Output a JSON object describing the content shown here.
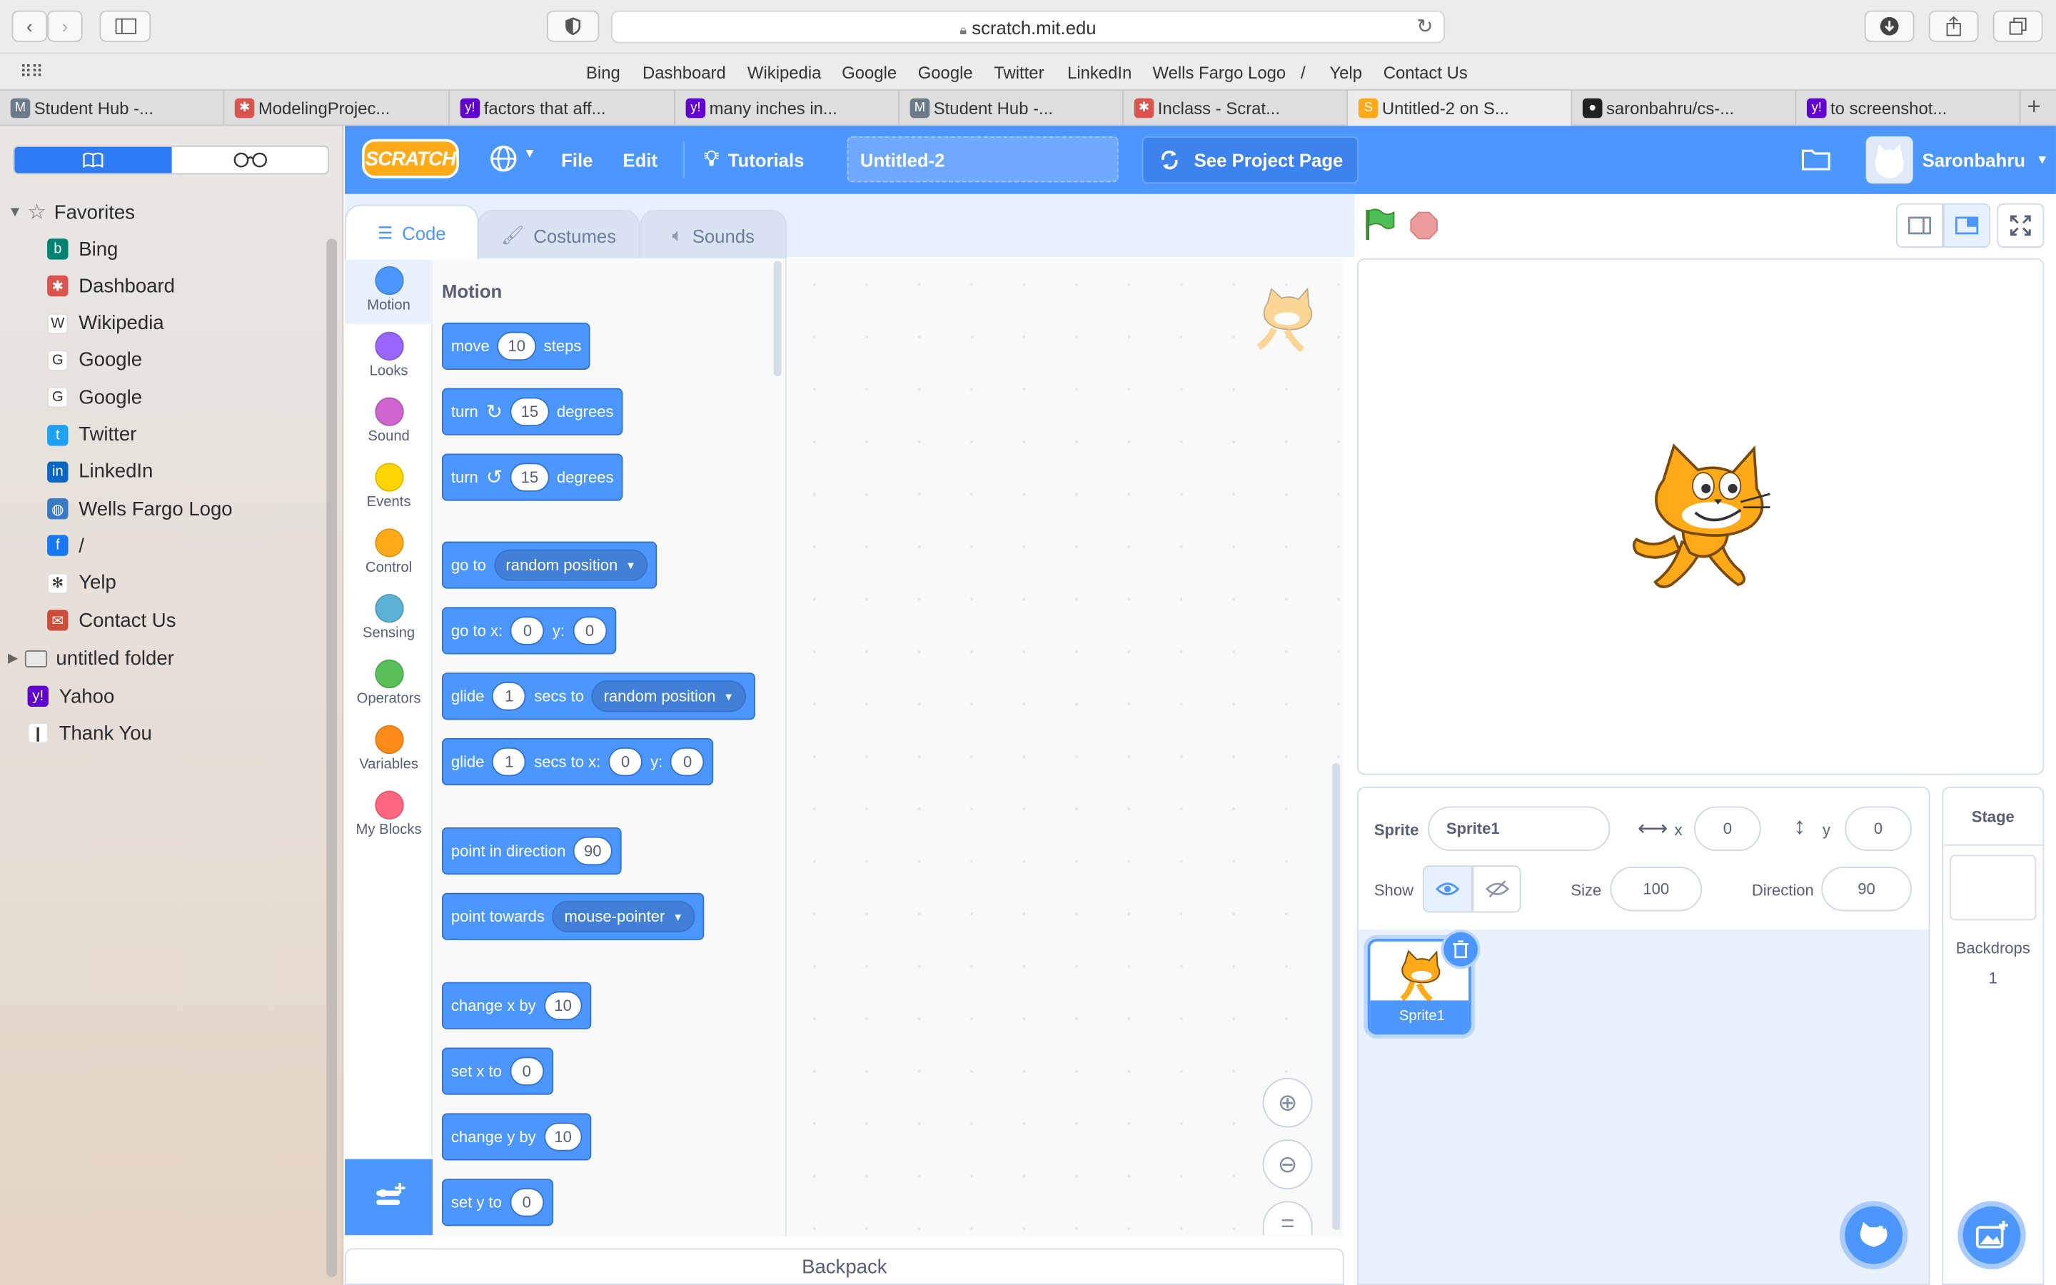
{
  "browser": {
    "url": "scratch.mit.edu",
    "favorites_bar": [
      "Bing",
      "Dashboard",
      "Wikipedia",
      "Google",
      "Google",
      "Twitter",
      "LinkedIn",
      "Wells Fargo Logo",
      "/",
      "Yelp",
      "Contact Us"
    ],
    "tabs": [
      {
        "label": "Student Hub -...",
        "color": "#6c7a89",
        "glyph": "M"
      },
      {
        "label": "ModelingProjec...",
        "color": "#d9534f",
        "glyph": "✱"
      },
      {
        "label": "factors that aff...",
        "color": "#6001d2",
        "glyph": "y!"
      },
      {
        "label": "many inches in...",
        "color": "#6001d2",
        "glyph": "y!"
      },
      {
        "label": "Student Hub -...",
        "color": "#6c7a89",
        "glyph": "M"
      },
      {
        "label": "Inclass - Scrat...",
        "color": "#d9534f",
        "glyph": "✱"
      },
      {
        "label": "Untitled-2 on S...",
        "color": "#ffab19",
        "glyph": "S"
      },
      {
        "label": "saronbahru/cs-...",
        "color": "#222222",
        "glyph": "●"
      },
      {
        "label": "to screenshot...",
        "color": "#6001d2",
        "glyph": "y!"
      }
    ]
  },
  "sidebar": {
    "heading": "Favorites",
    "items": [
      {
        "label": "Bing",
        "color": "#008373",
        "glyph": "b"
      },
      {
        "label": "Dashboard",
        "color": "#d9534f",
        "glyph": "✱"
      },
      {
        "label": "Wikipedia",
        "color": "#ffffff",
        "glyph": "W"
      },
      {
        "label": "Google",
        "color": "#ffffff",
        "glyph": "G"
      },
      {
        "label": "Google",
        "color": "#ffffff",
        "glyph": "G"
      },
      {
        "label": "Twitter",
        "color": "#1da1f2",
        "glyph": "t"
      },
      {
        "label": "LinkedIn",
        "color": "#0a66c2",
        "glyph": "in"
      },
      {
        "label": "Wells Fargo Logo",
        "color": "#3a78c2",
        "glyph": "◍"
      },
      {
        "label": "/",
        "color": "#1877f2",
        "glyph": "f"
      },
      {
        "label": "Yelp",
        "color": "#ffffff",
        "glyph": "✻"
      },
      {
        "label": "Contact Us",
        "color": "#c94f3a",
        "glyph": "✉"
      }
    ],
    "folder": "untitled folder",
    "extra": [
      {
        "label": "Yahoo",
        "color": "#6001d2",
        "glyph": "y!"
      },
      {
        "label": "Thank You",
        "color": "#ffffff",
        "glyph": "❙"
      }
    ]
  },
  "scratch": {
    "menu_file": "File",
    "menu_edit": "Edit",
    "tutorials": "Tutorials",
    "project_title": "Untitled-2",
    "see_project": "See Project Page",
    "username": "Saronbahru",
    "tab_code": "Code",
    "tab_costumes": "Costumes",
    "tab_sounds": "Sounds",
    "categories": [
      {
        "label": "Motion",
        "color": "#4c97ff"
      },
      {
        "label": "Looks",
        "color": "#9966ff"
      },
      {
        "label": "Sound",
        "color": "#cf63cf"
      },
      {
        "label": "Events",
        "color": "#ffd500"
      },
      {
        "label": "Control",
        "color": "#ffab19"
      },
      {
        "label": "Sensing",
        "color": "#5cb1d6"
      },
      {
        "label": "Operators",
        "color": "#59c059"
      },
      {
        "label": "Variables",
        "color": "#ff8c1a"
      },
      {
        "label": "My Blocks",
        "color": "#ff6680"
      }
    ],
    "palette_heading": "Motion",
    "blocks": {
      "move": {
        "t1": "move",
        "v1": "10",
        "t2": "steps"
      },
      "turn_cw": {
        "t1": "turn",
        "v1": "15",
        "t2": "degrees"
      },
      "turn_ccw": {
        "t1": "turn",
        "v1": "15",
        "t2": "degrees"
      },
      "goto": {
        "t1": "go to",
        "dd": "random position"
      },
      "goto_xy": {
        "t1": "go to x:",
        "v1": "0",
        "t2": "y:",
        "v2": "0"
      },
      "glide_to": {
        "t1": "glide",
        "v1": "1",
        "t2": "secs to",
        "dd": "random position"
      },
      "glide_xy": {
        "t1": "glide",
        "v1": "1",
        "t2": "secs to x:",
        "v2": "0",
        "t3": "y:",
        "v3": "0"
      },
      "point_dir": {
        "t1": "point in direction",
        "v1": "90"
      },
      "point_towards": {
        "t1": "point towards",
        "dd": "mouse-pointer"
      },
      "change_x": {
        "t1": "change x by",
        "v1": "10"
      },
      "set_x": {
        "t1": "set x to",
        "v1": "0"
      },
      "change_y": {
        "t1": "change y by",
        "v1": "10"
      },
      "set_y": {
        "t1": "set y to",
        "v1": "0"
      }
    },
    "backpack": "Backpack",
    "sprite_info": {
      "sprite_label": "Sprite",
      "sprite_name": "Sprite1",
      "x_label": "x",
      "x_value": "0",
      "y_label": "y",
      "y_value": "0",
      "show_label": "Show",
      "size_label": "Size",
      "size_value": "100",
      "direction_label": "Direction",
      "direction_value": "90"
    },
    "sprite_thumb_label": "Sprite1",
    "stage_panel": {
      "title": "Stage",
      "backdrops_label": "Backdrops",
      "backdrops_count": "1"
    }
  }
}
